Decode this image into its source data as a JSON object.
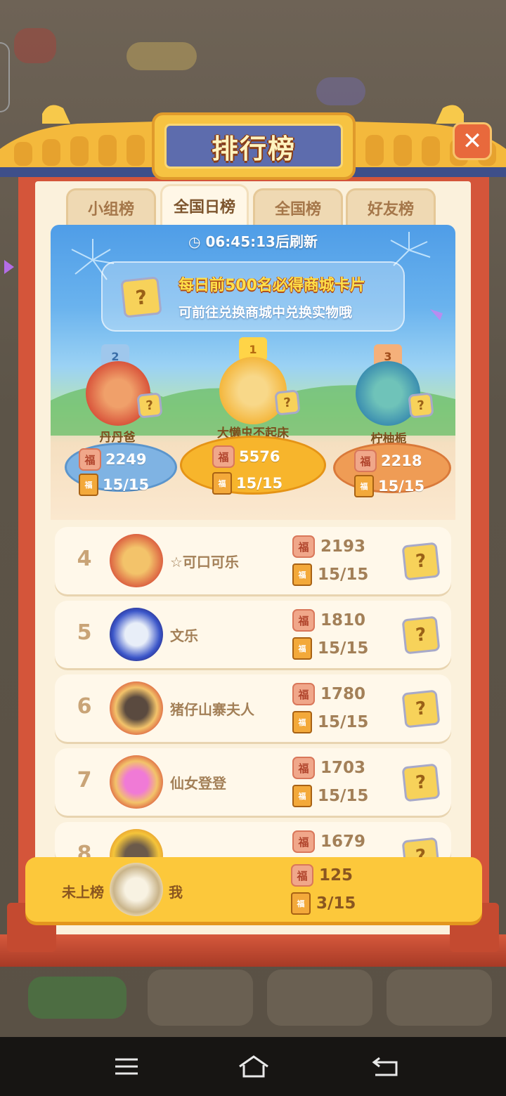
{
  "title": "排行榜",
  "close_label": "✕",
  "tabs": [
    {
      "label": "小组榜",
      "active": false
    },
    {
      "label": "全国日榜",
      "active": true
    },
    {
      "label": "全国榜",
      "active": false
    },
    {
      "label": "好友榜",
      "active": false
    }
  ],
  "timer": "06:45:13后刷新",
  "promo": {
    "line1": "每日前500名必得商城卡片",
    "line2": "可前往兑换商城中兑换实物哦",
    "card_icon": "mystery-card-icon"
  },
  "podium": [
    {
      "rank": "2",
      "name": "丹丹爸",
      "score": "2249",
      "progress": "15/15",
      "color": "#7fb3e3"
    },
    {
      "rank": "1",
      "name": "大懒虫不起床",
      "score": "5576",
      "progress": "15/15",
      "color": "#f7b52c"
    },
    {
      "rank": "3",
      "name": "柠柚栀",
      "score": "2218",
      "progress": "15/15",
      "color": "#ef9c55"
    }
  ],
  "list": [
    {
      "rank": "4",
      "name": "☆可口可乐",
      "score": "2193",
      "progress": "15/15"
    },
    {
      "rank": "5",
      "name": "文乐",
      "score": "1810",
      "progress": "15/15"
    },
    {
      "rank": "6",
      "name": "猪仔山寨夫人",
      "score": "1780",
      "progress": "15/15"
    },
    {
      "rank": "7",
      "name": "仙女登登",
      "score": "1703",
      "progress": "15/15"
    },
    {
      "rank": "8",
      "name": "",
      "score": "1679",
      "progress": ""
    }
  ],
  "me": {
    "status": "未上榜",
    "name": "我",
    "score": "125",
    "progress": "3/15"
  },
  "icons": {
    "coin": "福",
    "book": "福"
  },
  "colors": {
    "panel_red": "#d4553a",
    "panel_cream": "#fbf1dc",
    "gold": "#fcc83b",
    "title_blue": "#5d6cad"
  }
}
